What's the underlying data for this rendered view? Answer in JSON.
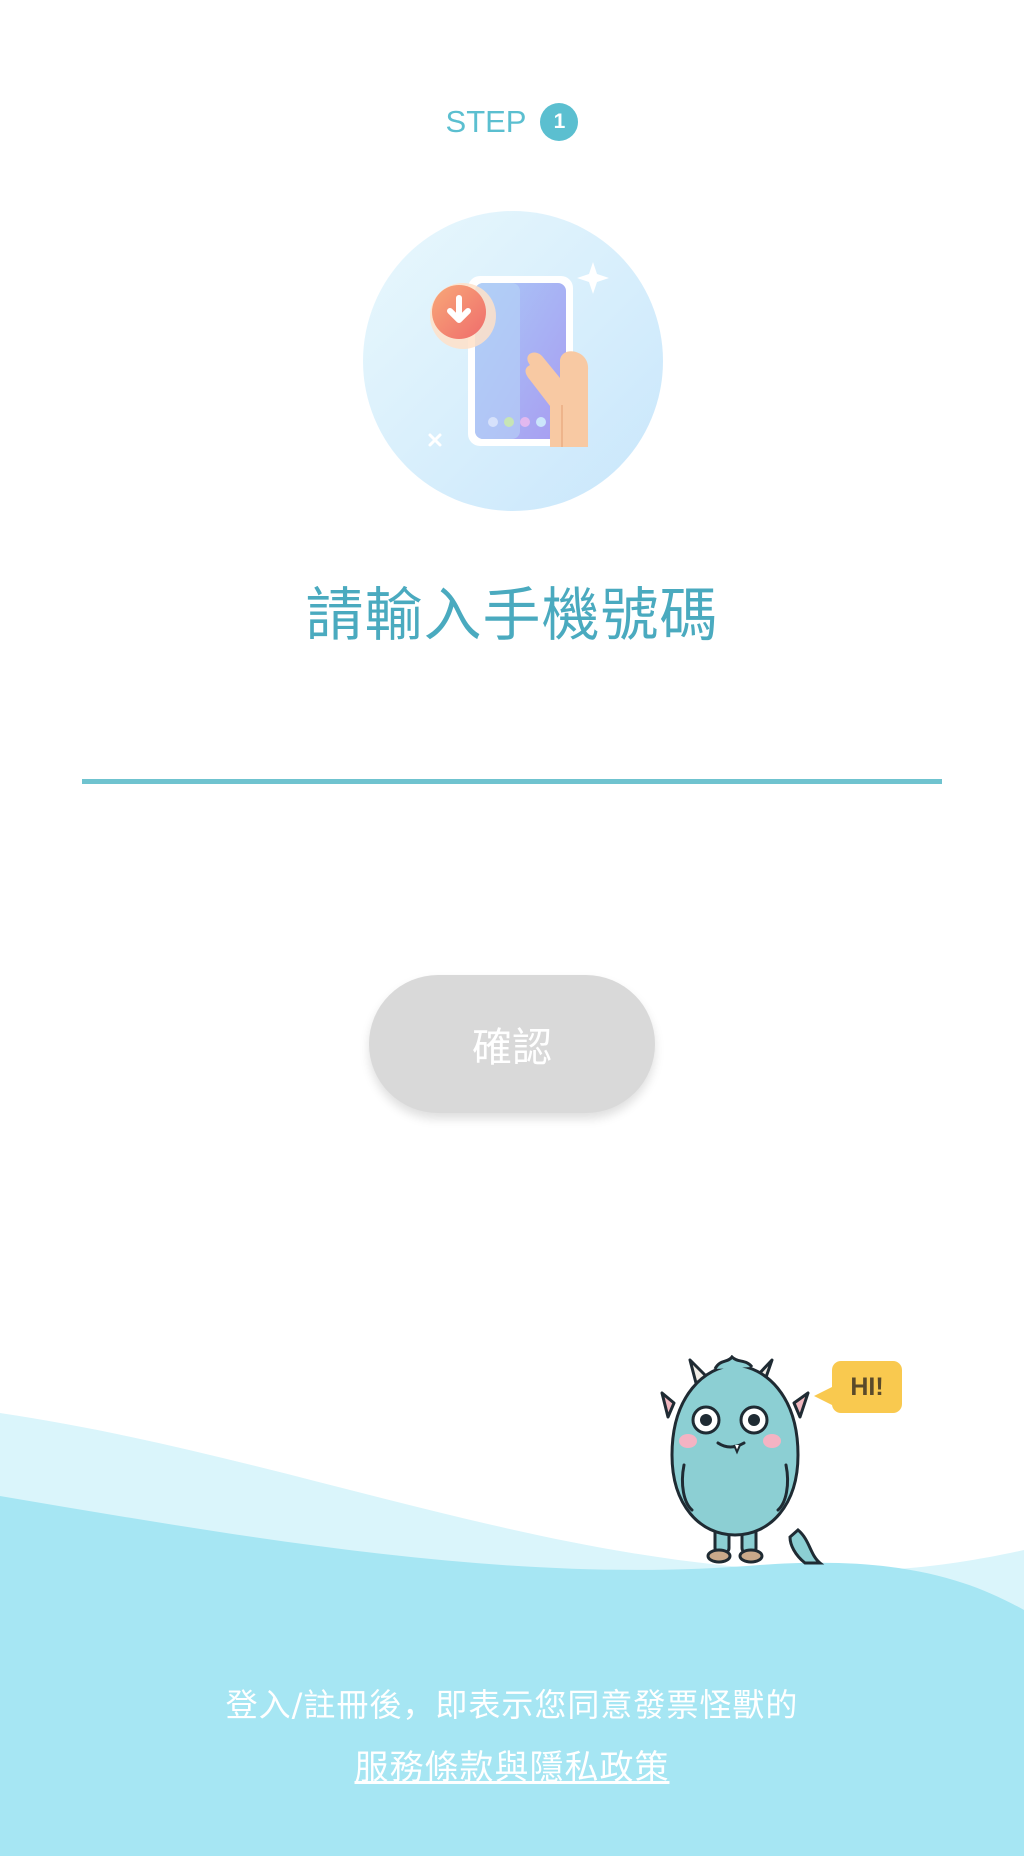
{
  "step": {
    "label": "STEP",
    "number": "1"
  },
  "hero": {
    "icon": "phone-download-illustration"
  },
  "title": "請輸入手機號碼",
  "phone_input": {
    "value": "",
    "placeholder": ""
  },
  "confirm_button": {
    "label": "確認"
  },
  "mascot": {
    "speech": "HI!"
  },
  "footer": {
    "notice": "登入/註冊後，即表示您同意發票怪獸的",
    "terms_link": "服務條款與隱私政策"
  },
  "colors": {
    "accent": "#5bbfd0",
    "title": "#4aaabf",
    "button_disabled": "#d9d9d9",
    "wave_light": "#daf5fb",
    "wave_main": "#a6e6f3",
    "bubble": "#f9c94f"
  }
}
